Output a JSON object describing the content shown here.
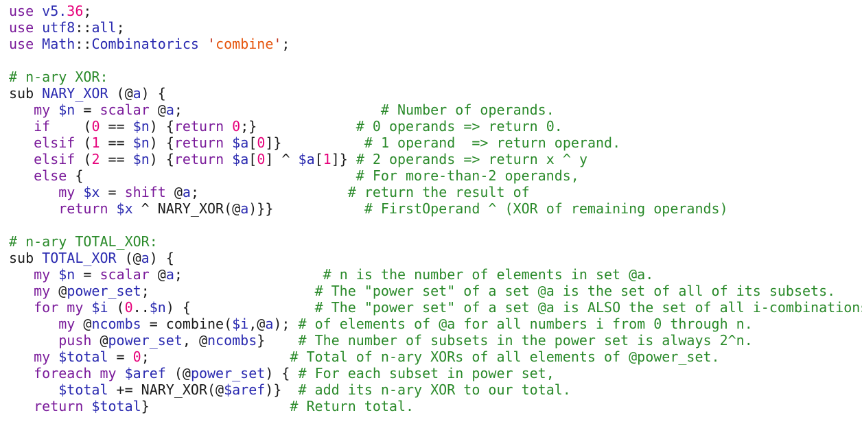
{
  "colors": {
    "background": "#ffffff",
    "keyword": "#7a1a9a",
    "identifier": "#2a2ab0",
    "number": "#e6007a",
    "comment": "#2a8a2a",
    "string": "#e6550d",
    "plain": "#1a1a1a"
  },
  "lines": [
    [
      [
        "k",
        "use"
      ],
      [
        "p",
        " "
      ],
      [
        "v",
        "v5."
      ],
      [
        "n",
        "36"
      ],
      [
        "p",
        ";"
      ]
    ],
    [
      [
        "k",
        "use"
      ],
      [
        "p",
        " "
      ],
      [
        "v",
        "utf8"
      ],
      [
        "p",
        "::"
      ],
      [
        "v",
        "all"
      ],
      [
        "p",
        ";"
      ]
    ],
    [
      [
        "k",
        "use"
      ],
      [
        "p",
        " "
      ],
      [
        "v",
        "Math"
      ],
      [
        "p",
        "::"
      ],
      [
        "v",
        "Combinatorics"
      ],
      [
        "p",
        " "
      ],
      [
        "q",
        "'"
      ],
      [
        "s",
        "combine"
      ],
      [
        "q",
        "'"
      ],
      [
        "p",
        ";"
      ]
    ],
    [],
    [
      [
        "c",
        "# n-ary XOR:"
      ]
    ],
    [
      [
        "p",
        "sub "
      ],
      [
        "v",
        "NARY_XOR"
      ],
      [
        "p",
        " (@"
      ],
      [
        "v",
        "a"
      ],
      [
        "p",
        ") {"
      ]
    ],
    [
      [
        "p",
        "   "
      ],
      [
        "k",
        "my"
      ],
      [
        "p",
        " "
      ],
      [
        "v",
        "$n"
      ],
      [
        "p",
        " = "
      ],
      [
        "k",
        "scalar"
      ],
      [
        "p",
        " @"
      ],
      [
        "v",
        "a"
      ],
      [
        "p",
        ";                        "
      ],
      [
        "c",
        "# Number of operands."
      ]
    ],
    [
      [
        "p",
        "   "
      ],
      [
        "k",
        "if"
      ],
      [
        "p",
        "    ("
      ],
      [
        "n",
        "0"
      ],
      [
        "p",
        " == "
      ],
      [
        "v",
        "$n"
      ],
      [
        "p",
        ") {"
      ],
      [
        "k",
        "return"
      ],
      [
        "p",
        " "
      ],
      [
        "n",
        "0"
      ],
      [
        "p",
        ";}            "
      ],
      [
        "c",
        "# 0 operands => return 0."
      ]
    ],
    [
      [
        "p",
        "   "
      ],
      [
        "k",
        "elsif"
      ],
      [
        "p",
        " ("
      ],
      [
        "n",
        "1"
      ],
      [
        "p",
        " == "
      ],
      [
        "v",
        "$n"
      ],
      [
        "p",
        ") {"
      ],
      [
        "k",
        "return"
      ],
      [
        "p",
        " "
      ],
      [
        "v",
        "$a"
      ],
      [
        "p",
        "["
      ],
      [
        "n",
        "0"
      ],
      [
        "p",
        "]}          "
      ],
      [
        "c",
        "# 1 operand  => return operand."
      ]
    ],
    [
      [
        "p",
        "   "
      ],
      [
        "k",
        "elsif"
      ],
      [
        "p",
        " ("
      ],
      [
        "n",
        "2"
      ],
      [
        "p",
        " == "
      ],
      [
        "v",
        "$n"
      ],
      [
        "p",
        ") {"
      ],
      [
        "k",
        "return"
      ],
      [
        "p",
        " "
      ],
      [
        "v",
        "$a"
      ],
      [
        "p",
        "["
      ],
      [
        "n",
        "0"
      ],
      [
        "p",
        "] ^ "
      ],
      [
        "v",
        "$a"
      ],
      [
        "p",
        "["
      ],
      [
        "n",
        "1"
      ],
      [
        "p",
        "]} "
      ],
      [
        "c",
        "# 2 operands => return x ^ y"
      ]
    ],
    [
      [
        "p",
        "   "
      ],
      [
        "k",
        "else"
      ],
      [
        "p",
        " {                                 "
      ],
      [
        "c",
        "# For more-than-2 operands,"
      ]
    ],
    [
      [
        "p",
        "      "
      ],
      [
        "k",
        "my"
      ],
      [
        "p",
        " "
      ],
      [
        "v",
        "$x"
      ],
      [
        "p",
        " = "
      ],
      [
        "k",
        "shift"
      ],
      [
        "p",
        " @"
      ],
      [
        "v",
        "a"
      ],
      [
        "p",
        ";                  "
      ],
      [
        "c",
        "# return the result of"
      ]
    ],
    [
      [
        "p",
        "      "
      ],
      [
        "k",
        "return"
      ],
      [
        "p",
        " "
      ],
      [
        "v",
        "$x"
      ],
      [
        "p",
        " ^ NARY_XOR(@"
      ],
      [
        "v",
        "a"
      ],
      [
        "p",
        ")}}           "
      ],
      [
        "c",
        "# FirstOperand ^ (XOR of remaining operands)"
      ]
    ],
    [],
    [
      [
        "c",
        "# n-ary TOTAL_XOR:"
      ]
    ],
    [
      [
        "p",
        "sub "
      ],
      [
        "v",
        "TOTAL_XOR"
      ],
      [
        "p",
        " (@"
      ],
      [
        "v",
        "a"
      ],
      [
        "p",
        ") {"
      ]
    ],
    [
      [
        "p",
        "   "
      ],
      [
        "k",
        "my"
      ],
      [
        "p",
        " "
      ],
      [
        "v",
        "$n"
      ],
      [
        "p",
        " = "
      ],
      [
        "k",
        "scalar"
      ],
      [
        "p",
        " @"
      ],
      [
        "v",
        "a"
      ],
      [
        "p",
        ";                 "
      ],
      [
        "c",
        "# n is the number of elements in set @a."
      ]
    ],
    [
      [
        "p",
        "   "
      ],
      [
        "k",
        "my"
      ],
      [
        "p",
        " @"
      ],
      [
        "v",
        "power_set"
      ],
      [
        "p",
        ";                    "
      ],
      [
        "c",
        "# The \"power set\" of a set @a is the set of all of its subsets."
      ]
    ],
    [
      [
        "p",
        "   "
      ],
      [
        "k",
        "for my"
      ],
      [
        "p",
        " "
      ],
      [
        "v",
        "$i"
      ],
      [
        "p",
        " ("
      ],
      [
        "n",
        "0"
      ],
      [
        "p",
        ".."
      ],
      [
        "v",
        "$n"
      ],
      [
        "p",
        ") {               "
      ],
      [
        "c",
        "# The \"power set\" of a set @a is ALSO the set of all i-combinations"
      ]
    ],
    [
      [
        "p",
        "      "
      ],
      [
        "k",
        "my"
      ],
      [
        "p",
        " @"
      ],
      [
        "v",
        "ncombs"
      ],
      [
        "p",
        " = combine("
      ],
      [
        "v",
        "$i"
      ],
      [
        "p",
        ",@"
      ],
      [
        "v",
        "a"
      ],
      [
        "p",
        "); "
      ],
      [
        "c",
        "# of elements of @a for all numbers i from 0 through n."
      ]
    ],
    [
      [
        "p",
        "      "
      ],
      [
        "k",
        "push"
      ],
      [
        "p",
        " @"
      ],
      [
        "v",
        "power_set"
      ],
      [
        "p",
        ", @"
      ],
      [
        "v",
        "ncombs"
      ],
      [
        "p",
        "}    "
      ],
      [
        "c",
        "# The number of subsets in the power set is always 2^n."
      ]
    ],
    [
      [
        "p",
        "   "
      ],
      [
        "k",
        "my"
      ],
      [
        "p",
        " "
      ],
      [
        "v",
        "$total"
      ],
      [
        "p",
        " = "
      ],
      [
        "n",
        "0"
      ],
      [
        "p",
        ";                 "
      ],
      [
        "c",
        "# Total of n-ary XORs of all elements of @power_set."
      ]
    ],
    [
      [
        "p",
        "   "
      ],
      [
        "k",
        "foreach my"
      ],
      [
        "p",
        " "
      ],
      [
        "v",
        "$aref"
      ],
      [
        "p",
        " (@"
      ],
      [
        "v",
        "power_set"
      ],
      [
        "p",
        ") { "
      ],
      [
        "c",
        "# For each subset in power set,"
      ]
    ],
    [
      [
        "p",
        "      "
      ],
      [
        "v",
        "$total"
      ],
      [
        "p",
        " += NARY_XOR(@"
      ],
      [
        "v",
        "$aref"
      ],
      [
        "p",
        ")}  "
      ],
      [
        "c",
        "# add its n-ary XOR to our total."
      ]
    ],
    [
      [
        "p",
        "   "
      ],
      [
        "k",
        "return"
      ],
      [
        "p",
        " "
      ],
      [
        "v",
        "$total"
      ],
      [
        "p",
        "}                 "
      ],
      [
        "c",
        "# Return total."
      ]
    ]
  ]
}
